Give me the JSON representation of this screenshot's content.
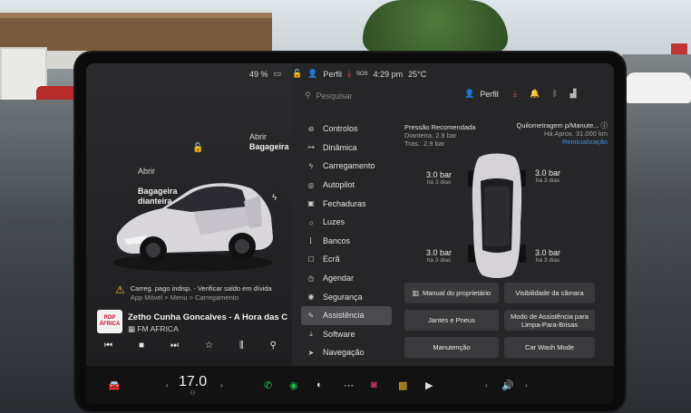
{
  "status": {
    "battery": "49 %",
    "profile": "Perfil",
    "sos": "SOS",
    "time": "4:29 pm",
    "outside_temp": "25°C"
  },
  "left_panel": {
    "rear_trunk": {
      "action": "Abrir",
      "name": "Bagageira"
    },
    "front_trunk": {
      "action": "Abrir",
      "name": "Bagageira\ndianteira"
    },
    "alert": {
      "line1": "Carreg. pago indisp. - Verificar saldo em dívida",
      "line2": "App Móvel > Menu > Carregamento"
    },
    "media": {
      "album_text": "RDP ÁFRICA",
      "track": "Zetho Cunha Goncalves - A Hora das Cigarras",
      "station": "FM AFRICA"
    }
  },
  "controls": {
    "search_placeholder": "Pesquisar",
    "profile": "Perfil",
    "menu": [
      {
        "label": "Controlos",
        "icon": "toggle-icon"
      },
      {
        "label": "Dinâmica",
        "icon": "car-icon"
      },
      {
        "label": "Carregamento",
        "icon": "bolt-icon"
      },
      {
        "label": "Autopilot",
        "icon": "steering-wheel-icon"
      },
      {
        "label": "Fechaduras",
        "icon": "lock-icon"
      },
      {
        "label": "Luzes",
        "icon": "sun-icon"
      },
      {
        "label": "Bancos",
        "icon": "seat-icon"
      },
      {
        "label": "Ecrã",
        "icon": "display-icon"
      },
      {
        "label": "Agendar",
        "icon": "clock-icon"
      },
      {
        "label": "Segurança",
        "icon": "shield-icon"
      },
      {
        "label": "Assistência",
        "icon": "wrench-icon"
      },
      {
        "label": "Software",
        "icon": "download-icon"
      },
      {
        "label": "Navegação",
        "icon": "navigation-icon"
      }
    ],
    "active_item": "Assistência"
  },
  "service": {
    "pressure_title": "Pressão Recomendada",
    "front": "Dianteira: 2.9 bar",
    "rear": "Tras.: 2.9 bar",
    "odometer_title": "Quilometragem p/Manute...",
    "odometer_value": "Há Aprox. 31.000 km",
    "reset": "Reinicialização",
    "tires": {
      "front_left": {
        "pressure": "3.0 bar",
        "ago": "há 3 dias"
      },
      "front_right": {
        "pressure": "3.0 bar",
        "ago": "há 3 dias"
      },
      "rear_left": {
        "pressure": "3.0 bar",
        "ago": "há 3 dias"
      },
      "rear_right": {
        "pressure": "3.0 bar",
        "ago": "há 3 dias"
      }
    },
    "buttons": {
      "manual": "Manual do proprietário",
      "camera": "Visibilidade da câmara",
      "wheels": "Jantes e Pneus",
      "wiper": "Modo de Assistência para Limpa-Para-Brisas",
      "maintenance": "Manutenção",
      "carwash": "Car Wash Mode"
    }
  },
  "bottom_bar": {
    "cabin_temp": "17.0",
    "icons": [
      "car-icon",
      "phone-icon",
      "spotify-icon",
      "camera-app-icon",
      "more-icon",
      "record-icon",
      "games-icon",
      "video-icon",
      "volume-icon"
    ]
  },
  "colors": {
    "accent_link": "#4a8fe0",
    "alert": "#f0b82c",
    "active_menu": "#4b4b4f",
    "phone_green": "#35c759",
    "spotify_green": "#1db954"
  }
}
